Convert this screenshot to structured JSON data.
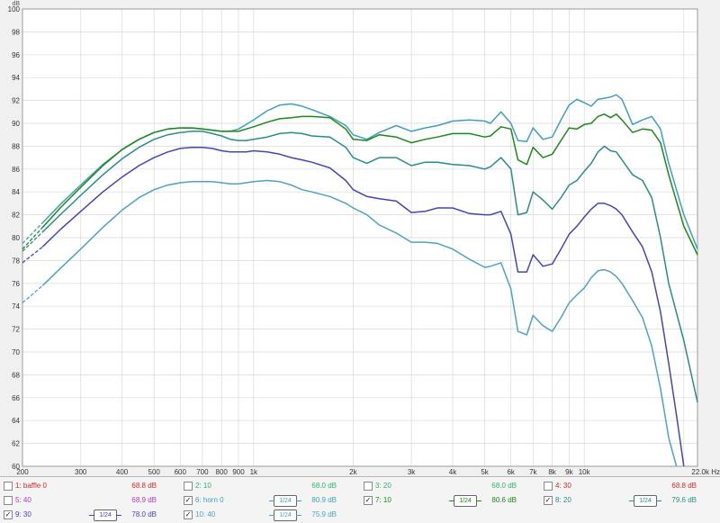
{
  "chart_data": {
    "type": "line",
    "ylabel": "dB",
    "xlabel_unit": "Hz",
    "xscale": "log",
    "xlim": [
      200,
      22000
    ],
    "ylim": [
      60,
      100
    ],
    "y_ticks": [
      60,
      62,
      64,
      66,
      68,
      70,
      72,
      74,
      76,
      78,
      80,
      82,
      84,
      86,
      88,
      90,
      92,
      94,
      96,
      98,
      100
    ],
    "x_ticks": [
      {
        "value": 200,
        "label": "200"
      },
      {
        "value": 300,
        "label": "300"
      },
      {
        "value": 400,
        "label": "400"
      },
      {
        "value": 500,
        "label": "500"
      },
      {
        "value": 600,
        "label": "600"
      },
      {
        "value": 700,
        "label": "700"
      },
      {
        "value": 800,
        "label": "800"
      },
      {
        "value": 900,
        "label": "900"
      },
      {
        "value": 1000,
        "label": "1k"
      },
      {
        "value": 2000,
        "label": "2k"
      },
      {
        "value": 3000,
        "label": "3k"
      },
      {
        "value": 4000,
        "label": "4k"
      },
      {
        "value": 5000,
        "label": "5k"
      },
      {
        "value": 6000,
        "label": "6k"
      },
      {
        "value": 7000,
        "label": "7k"
      },
      {
        "value": 8000,
        "label": "8k"
      },
      {
        "value": 9000,
        "label": "9k"
      },
      {
        "value": 10000,
        "label": "10k"
      },
      {
        "value": 22000,
        "label": "22.0k Hz"
      }
    ],
    "grid": true,
    "legend": "bottom",
    "series": [
      {
        "name": "6: horn 0",
        "color": "#3f9fbe",
        "x": [
          200,
          230,
          260,
          300,
          350,
          400,
          450,
          500,
          550,
          600,
          650,
          700,
          750,
          800,
          850,
          900,
          950,
          1000,
          1100,
          1200,
          1300,
          1400,
          1500,
          1700,
          1900,
          2000,
          2200,
          2400,
          2700,
          3000,
          3300,
          3600,
          4000,
          4500,
          5000,
          5200,
          5600,
          6000,
          6300,
          6700,
          7000,
          7500,
          8000,
          8500,
          9000,
          9500,
          10000,
          10500,
          11000,
          11500,
          12000,
          12500,
          13000,
          14000,
          15000,
          16000,
          17000,
          18000,
          20000,
          22000
        ],
        "y": [
          79.5,
          81.3,
          82.9,
          84.6,
          86.4,
          87.7,
          88.6,
          89.2,
          89.5,
          89.6,
          89.6,
          89.5,
          89.4,
          89.3,
          89.3,
          89.5,
          89.9,
          90.3,
          91.1,
          91.6,
          91.7,
          91.5,
          91.2,
          90.6,
          89.8,
          89.0,
          88.6,
          89.2,
          89.8,
          89.3,
          89.6,
          89.8,
          90.2,
          90.3,
          90.2,
          90.0,
          91.0,
          90.0,
          88.5,
          88.4,
          89.6,
          88.6,
          88.8,
          90.3,
          91.6,
          92.1,
          91.8,
          91.5,
          92.1,
          92.2,
          92.3,
          92.5,
          92.1,
          89.9,
          90.3,
          90.6,
          89.5,
          86.5,
          82.0,
          79.0
        ]
      },
      {
        "name": "7: 10",
        "color": "#1a8a1a",
        "x": [
          200,
          230,
          260,
          300,
          350,
          400,
          450,
          500,
          550,
          600,
          650,
          700,
          750,
          800,
          850,
          900,
          950,
          1000,
          1100,
          1200,
          1300,
          1400,
          1500,
          1700,
          1900,
          2000,
          2200,
          2400,
          2700,
          3000,
          3300,
          3600,
          4000,
          4500,
          5000,
          5200,
          5600,
          6000,
          6300,
          6700,
          7000,
          7500,
          8000,
          8500,
          9000,
          9500,
          10000,
          10500,
          11000,
          11500,
          12000,
          12500,
          13000,
          14000,
          15000,
          16000,
          17000,
          18000,
          20000,
          22000
        ],
        "y": [
          79.0,
          80.9,
          82.6,
          84.4,
          86.3,
          87.7,
          88.6,
          89.2,
          89.5,
          89.6,
          89.6,
          89.5,
          89.4,
          89.3,
          89.3,
          89.3,
          89.5,
          89.7,
          90.1,
          90.4,
          90.5,
          90.6,
          90.6,
          90.5,
          89.5,
          88.6,
          88.5,
          89.0,
          88.8,
          88.3,
          88.6,
          88.8,
          89.1,
          89.1,
          88.8,
          88.9,
          89.7,
          89.5,
          86.8,
          86.4,
          87.9,
          87.0,
          87.3,
          88.5,
          89.6,
          89.5,
          89.9,
          90.0,
          90.6,
          90.8,
          90.5,
          90.8,
          90.3,
          89.2,
          89.5,
          89.4,
          88.3,
          85.5,
          81.0,
          78.5
        ]
      },
      {
        "name": "8: 20",
        "color": "#2a8c8a",
        "x": [
          200,
          230,
          260,
          300,
          350,
          400,
          450,
          500,
          550,
          600,
          650,
          700,
          750,
          800,
          850,
          900,
          950,
          1000,
          1100,
          1200,
          1300,
          1400,
          1500,
          1700,
          1900,
          2000,
          2200,
          2400,
          2700,
          3000,
          3300,
          3600,
          4000,
          4500,
          5000,
          5200,
          5600,
          6000,
          6300,
          6700,
          7000,
          7500,
          8000,
          8500,
          9000,
          9500,
          10000,
          10500,
          11000,
          11500,
          12000,
          12500,
          13000,
          14000,
          15000,
          16000,
          17000,
          18000,
          20000,
          22000
        ],
        "y": [
          78.8,
          80.5,
          82.0,
          83.7,
          85.5,
          86.9,
          87.9,
          88.6,
          89.0,
          89.2,
          89.3,
          89.3,
          89.1,
          88.9,
          88.6,
          88.5,
          88.5,
          88.6,
          88.8,
          89.1,
          89.2,
          89.1,
          88.9,
          88.8,
          87.9,
          87.0,
          86.5,
          87.0,
          87.0,
          86.3,
          86.6,
          86.6,
          86.4,
          86.3,
          86.0,
          86.2,
          87.0,
          86.0,
          82.0,
          82.2,
          84.0,
          83.3,
          82.5,
          83.5,
          84.6,
          85.0,
          85.8,
          86.5,
          87.5,
          88.0,
          87.6,
          87.5,
          86.8,
          85.5,
          85.0,
          83.5,
          80.0,
          76.0,
          71.0,
          65.6
        ]
      },
      {
        "name": "9: 30",
        "color": "#4545b8",
        "x": [
          200,
          230,
          260,
          300,
          350,
          400,
          450,
          500,
          550,
          600,
          650,
          700,
          750,
          800,
          850,
          900,
          950,
          1000,
          1100,
          1200,
          1300,
          1400,
          1500,
          1700,
          1900,
          2000,
          2200,
          2400,
          2700,
          3000,
          3300,
          3600,
          4000,
          4500,
          5000,
          5200,
          5600,
          6000,
          6300,
          6700,
          7000,
          7500,
          8000,
          8500,
          9000,
          9500,
          10000,
          10500,
          11000,
          11500,
          12000,
          12500,
          13000,
          14000,
          15000,
          16000,
          17000,
          18000,
          19000,
          20000
        ],
        "y": [
          77.8,
          79.2,
          80.7,
          82.3,
          84.0,
          85.3,
          86.3,
          87.0,
          87.5,
          87.8,
          87.9,
          87.9,
          87.8,
          87.6,
          87.5,
          87.5,
          87.5,
          87.6,
          87.5,
          87.3,
          87.0,
          86.8,
          86.6,
          86.1,
          85.0,
          84.2,
          83.6,
          83.4,
          83.2,
          82.2,
          82.3,
          82.6,
          82.6,
          82.1,
          82.0,
          82.0,
          82.3,
          80.3,
          77.0,
          77.0,
          78.5,
          77.5,
          77.7,
          79.0,
          80.3,
          81.0,
          81.8,
          82.5,
          83.0,
          83.0,
          82.8,
          82.5,
          82.0,
          80.5,
          79.2,
          77.0,
          73.5,
          69.0,
          64.5,
          60.0
        ]
      },
      {
        "name": "10: 40",
        "color": "#4ea3c2",
        "x": [
          200,
          230,
          260,
          300,
          350,
          400,
          450,
          500,
          550,
          600,
          650,
          700,
          750,
          800,
          850,
          900,
          950,
          1000,
          1100,
          1200,
          1300,
          1400,
          1500,
          1700,
          1900,
          2000,
          2200,
          2400,
          2700,
          3000,
          3300,
          3600,
          4000,
          4500,
          5000,
          5200,
          5600,
          6000,
          6300,
          6700,
          7000,
          7500,
          8000,
          8500,
          9000,
          9500,
          10000,
          10500,
          11000,
          11500,
          12000,
          12500,
          13000,
          14000,
          15000,
          16000,
          17000,
          18000,
          19000
        ],
        "y": [
          74.3,
          75.8,
          77.3,
          79.0,
          80.9,
          82.4,
          83.5,
          84.2,
          84.6,
          84.8,
          84.9,
          84.9,
          84.9,
          84.8,
          84.7,
          84.7,
          84.8,
          84.9,
          85.0,
          84.9,
          84.6,
          84.2,
          84.0,
          83.6,
          83.0,
          82.6,
          82.0,
          81.1,
          80.4,
          79.6,
          79.6,
          79.5,
          79.0,
          78.1,
          77.4,
          77.5,
          77.8,
          75.5,
          71.8,
          71.5,
          73.2,
          72.3,
          71.8,
          73.0,
          74.3,
          75.0,
          75.6,
          76.5,
          77.1,
          77.2,
          77.0,
          76.6,
          76.0,
          74.5,
          73.0,
          70.5,
          66.8,
          62.5,
          60.0
        ]
      }
    ]
  },
  "legend": {
    "items": [
      {
        "label": "1: baffle 0",
        "value": "68.8 dB",
        "checked": "",
        "color": "#d12a2a",
        "smoothing": ""
      },
      {
        "label": "2: 10",
        "value": "68.0 dB",
        "checked": "",
        "color": "#2bb56a",
        "smoothing": ""
      },
      {
        "label": "3: 20",
        "value": "68.0 dB",
        "checked": "",
        "color": "#2bb56a",
        "smoothing": ""
      },
      {
        "label": "4: 30",
        "value": "68.8 dB",
        "checked": "",
        "color": "#d12a2a",
        "smoothing": ""
      },
      {
        "label": "5: 40",
        "value": "68.9 dB",
        "checked": "",
        "color": "#b03ab8",
        "smoothing": ""
      },
      {
        "label": "6: horn 0",
        "value": "80.9 dB",
        "checked": "✓",
        "color": "#3f9fbe",
        "smoothing": "1/24"
      },
      {
        "label": "7: 10",
        "value": "80.6 dB",
        "checked": "✓",
        "color": "#1a8a1a",
        "smoothing": "1/24"
      },
      {
        "label": "8: 20",
        "value": "79.6 dB",
        "checked": "✓",
        "color": "#2a8c8a",
        "smoothing": "1/24"
      },
      {
        "label": "9: 30",
        "value": "78.0 dB",
        "checked": "✓",
        "color": "#4545b8",
        "smoothing": "1/24"
      },
      {
        "label": "10: 40",
        "value": "75.9 dB",
        "checked": "✓",
        "color": "#4ea3c2",
        "smoothing": "1/24"
      }
    ]
  }
}
